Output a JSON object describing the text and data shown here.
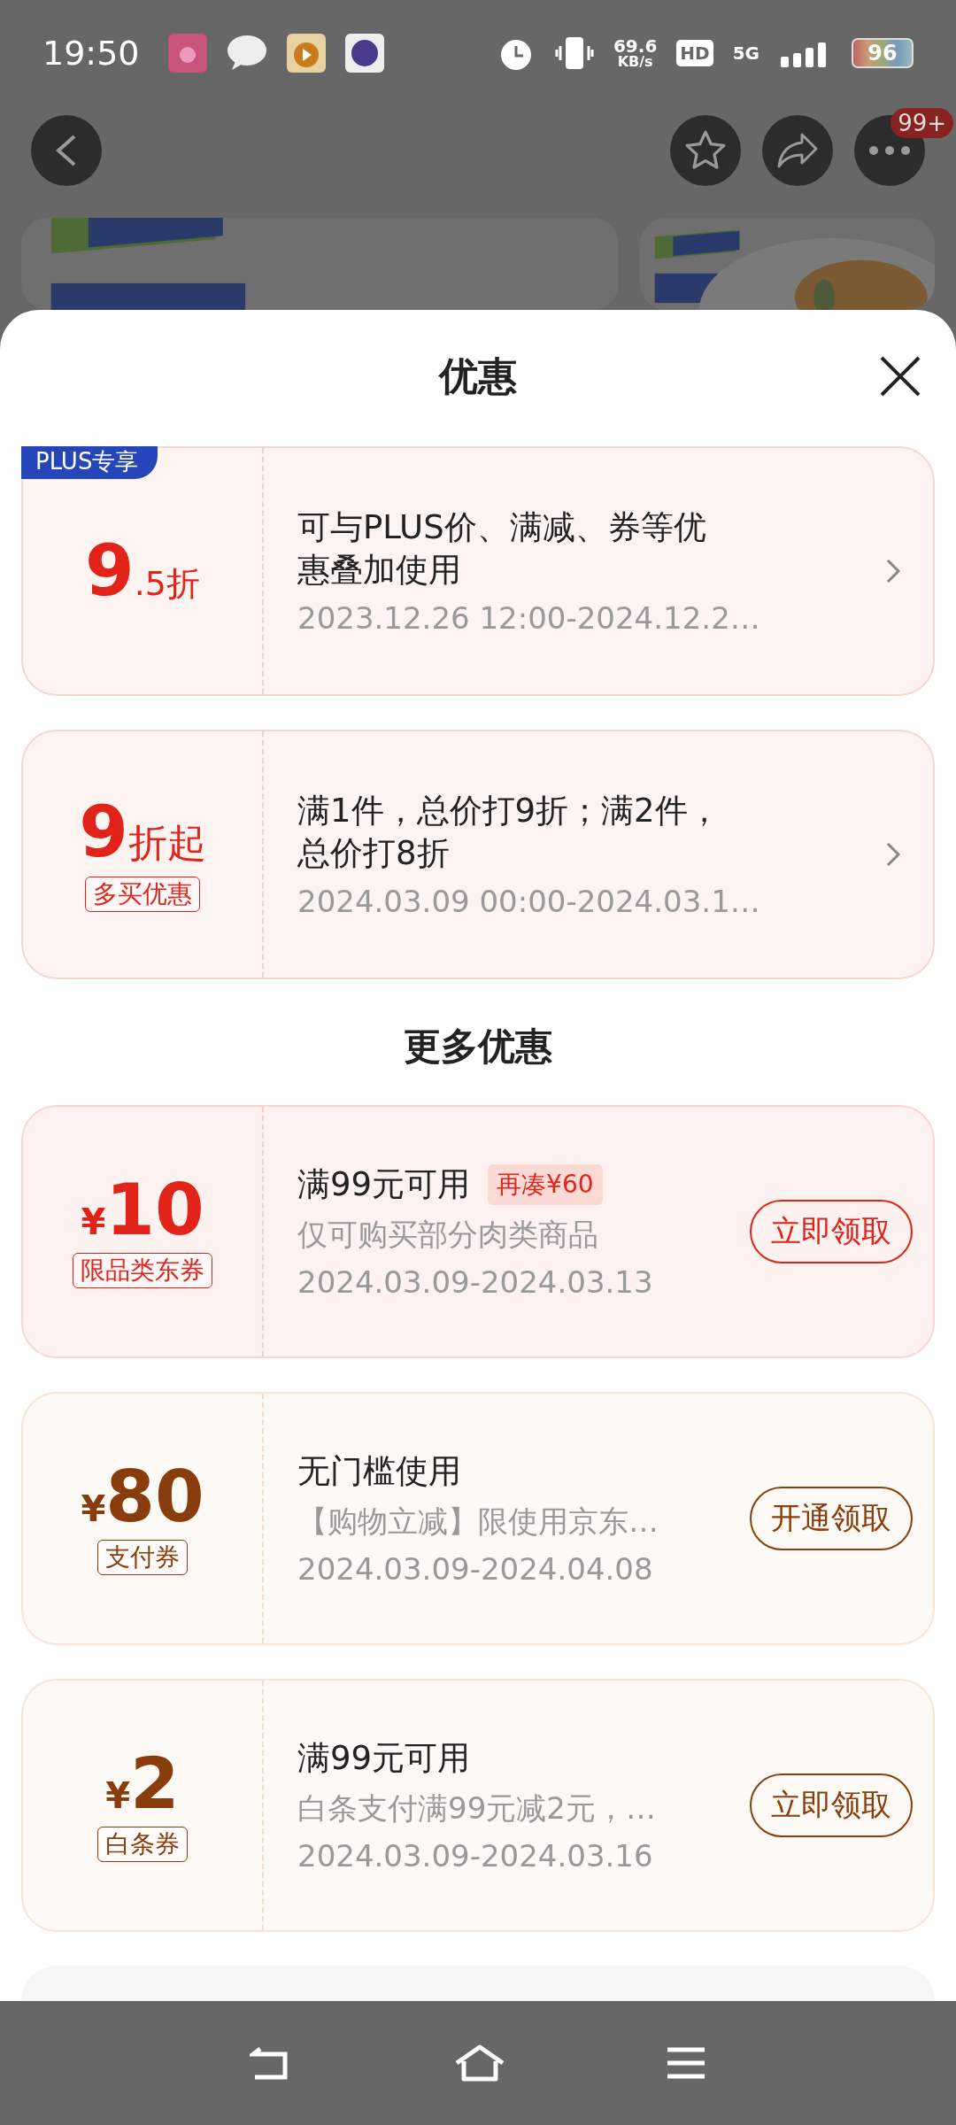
{
  "status_bar": {
    "time": "19:50",
    "net_speed": "69.6",
    "net_unit": "KB/s",
    "hd": "HD",
    "network": "5G",
    "battery": "96"
  },
  "top_bar": {
    "badge": "99+"
  },
  "sheet": {
    "title": "优惠"
  },
  "promotions": [
    {
      "kind": "plus",
      "tag": "PLUS专享",
      "big": "9",
      "small": ".5折",
      "description": "可与PLUS价、满减、券等优惠叠加使用",
      "period": "2023.12.26 12:00-2024.12.2…"
    },
    {
      "kind": "multi",
      "big": "9",
      "small": "折起",
      "label": "多买优惠",
      "description": "满1件，总价打9折；满2件，总价打8折",
      "period": "2024.03.09 00:00-2024.03.1…"
    }
  ],
  "section_title": "更多优惠",
  "coupons": [
    {
      "currency": "¥",
      "amount": "10",
      "label": "限品类东券",
      "title": "满99元可用",
      "hint": "再凑¥60",
      "description": "仅可购买部分肉类商品",
      "period": "2024.03.09-2024.03.13",
      "action": "立即领取",
      "color": "#e2231a"
    },
    {
      "currency": "¥",
      "amount": "80",
      "label": "支付券",
      "title": "无门槛使用",
      "description": "【购物立减】限使用京东…",
      "period": "2024.03.09-2024.04.08",
      "action": "开通领取",
      "color": "#8a3d0c"
    },
    {
      "currency": "¥",
      "amount": "2",
      "label": "白条券",
      "title": "满99元可用",
      "description": "白条支付满99元减2元，…",
      "period": "2024.03.09-2024.03.16",
      "action": "立即领取",
      "color": "#8a3d0c"
    }
  ]
}
